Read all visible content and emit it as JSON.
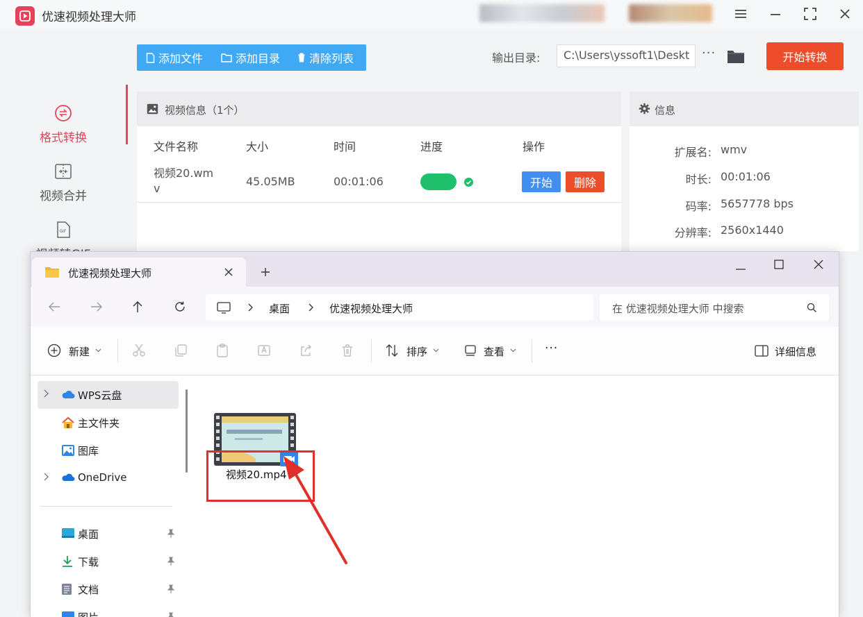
{
  "app": {
    "title": "优速视频处理大师",
    "colors": {
      "accent": "#e8415a",
      "primary_blue": "#3fa9f5",
      "danger": "#ee4d2b",
      "success": "#1fbf6b"
    },
    "sidebar": {
      "items": [
        {
          "label": "格式转换",
          "icon": "convert-icon",
          "active": true
        },
        {
          "label": "视频合并",
          "icon": "merge-icon",
          "active": false
        },
        {
          "label": "视频转GIF",
          "icon": "gif-icon",
          "active": false
        }
      ]
    },
    "toolbar": {
      "add_file": "添加文件",
      "add_dir": "添加目录",
      "clear_list": "清除列表",
      "output_label": "输出目录:",
      "output_path": "C:\\Users\\yssoft1\\Deskt",
      "more": "···",
      "start_convert": "开始转换"
    },
    "video_panel": {
      "title": "视频信息（1个）",
      "columns": [
        "文件名称",
        "大小",
        "时间",
        "进度",
        "操作"
      ],
      "rows": [
        {
          "name_line1": "视频20.wm",
          "name_line2": "v",
          "size": "45.05MB",
          "time": "00:01:06",
          "progress": 1.0,
          "start": "开始",
          "delete": "删除"
        }
      ]
    },
    "info_panel": {
      "title": "信息",
      "fields": [
        {
          "key": "扩展名:",
          "value": "wmv"
        },
        {
          "key": "时长:",
          "value": "00:01:06"
        },
        {
          "key": "码率:",
          "value": "5657778 bps"
        },
        {
          "key": "分辨率:",
          "value": "2560x1440"
        }
      ]
    }
  },
  "explorer": {
    "tab_title": "优速视频处理大师",
    "address": {
      "segments": [
        "桌面",
        "优速视频处理大师"
      ]
    },
    "search_placeholder": "在 优速视频处理大师 中搜索",
    "commands": {
      "new": "新建",
      "sort": "排序",
      "view": "查看",
      "more": "···",
      "details": "详细信息"
    },
    "nav": [
      {
        "label": "WPS云盘",
        "icon": "cloud-icon",
        "expandable": true,
        "selected": true
      },
      {
        "label": "主文件夹",
        "icon": "home-icon",
        "expandable": false
      },
      {
        "label": "图库",
        "icon": "gallery-icon",
        "expandable": false
      },
      {
        "label": "OneDrive",
        "icon": "onedrive-icon",
        "expandable": true
      },
      {
        "label": "桌面",
        "icon": "desktop-icon",
        "pinned": true
      },
      {
        "label": "下载",
        "icon": "download-icon",
        "pinned": true
      },
      {
        "label": "文档",
        "icon": "document-icon",
        "pinned": true
      },
      {
        "label": "图片",
        "icon": "pictures-icon",
        "pinned": true
      }
    ],
    "files": [
      {
        "name": "视频20.mp4",
        "icon": "video-file-icon",
        "thumbnail_text": "如何批量修改文件后缀名?"
      }
    ]
  }
}
